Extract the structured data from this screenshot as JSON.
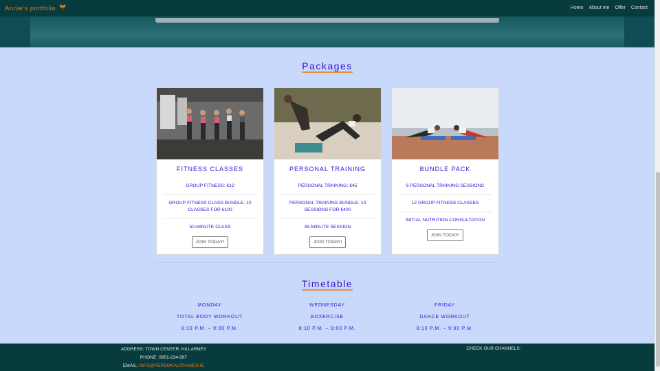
{
  "navbar": {
    "brand": "Annie's portfolio",
    "links": [
      "Home",
      "About me",
      "Offer",
      "Contact"
    ]
  },
  "packages": {
    "title": "Packages",
    "cards": [
      {
        "title": "FITNESS CLASSES",
        "items": [
          "GROUP FITNESS: €12",
          "GROUP FITNESS CLASS BUNDLE: 10 CLASSES FOR €100",
          "50-MINUTE CLASS"
        ],
        "button": "JOIN TODAY!"
      },
      {
        "title": "PERSONAL TRAINING",
        "items": [
          "PERSONAL TRAINING: €45",
          "PERSONAL TRAINING BUNDLE: 10 SESSIONS FOR €400",
          "45-MINUTE SESSION"
        ],
        "button": "JOIN TODAY!"
      },
      {
        "title": "BUNDLE PACK",
        "items": [
          "6 PERSONAL TRAINING SESSIONS",
          "12 GROUP FITNESS CLASSES",
          "INITIAL NUTRITION CONSULTATION"
        ],
        "button": "JOIN TODAY!"
      }
    ]
  },
  "timetable": {
    "title": "Timetable",
    "days": [
      {
        "day": "MONDAY",
        "class": "TOTAL BODY WORKOUT",
        "time": "8:10 P.M. – 9:00 P.M."
      },
      {
        "day": "WEDNESDAY",
        "class": "BOXERCISE",
        "time": "8:10 P.M. – 9:00 P.M."
      },
      {
        "day": "FRIDAY",
        "class": "DANCE WORKOUT",
        "time": "8:10 P.M. – 9:00 P.M."
      }
    ]
  },
  "footer": {
    "address": "ADDRESS: TOWN CENTER, KILLARNEY",
    "phone": "PHONE: 0851-234-567",
    "email_label": "EMAIL: ",
    "email": "INFO@PERSONALTRAINER.IE",
    "channels_label": "CHECK OUR CHANNELS:",
    "icons": [
      "facebook-icon",
      "instagram-icon",
      "youtube-icon"
    ]
  },
  "colors": {
    "accent": "#3b10d6",
    "brand_orange": "#e27a1f",
    "navbar_bg": "#073b3d",
    "page_bg": "#c9d9fb"
  }
}
